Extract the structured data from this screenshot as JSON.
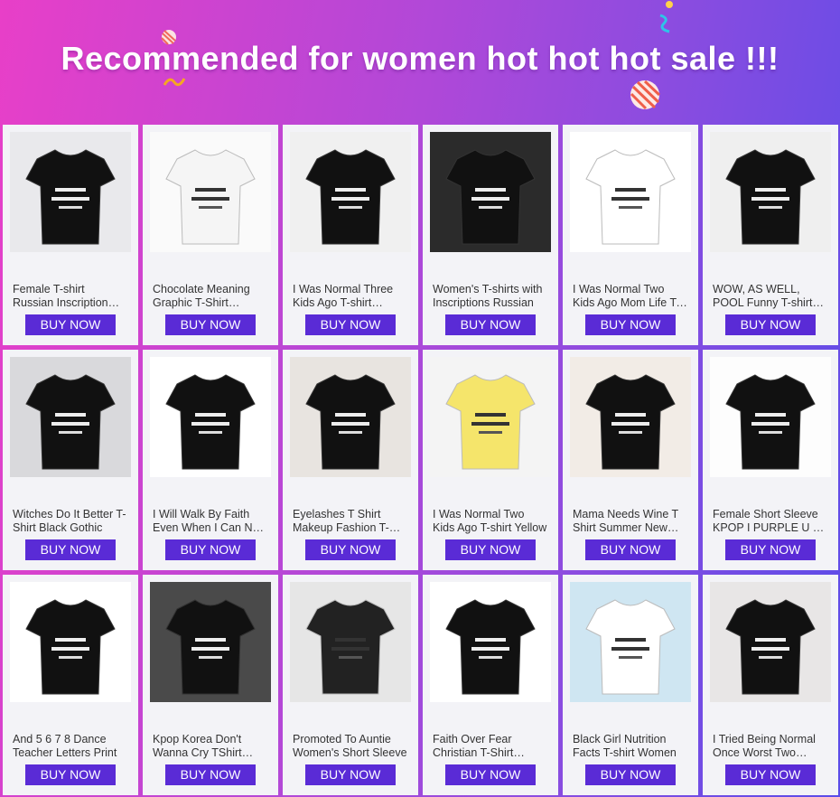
{
  "banner": {
    "title": "Recommended for women hot hot hot sale !!!"
  },
  "colors": {
    "button": "#5a2bd6",
    "card_bg": "#f3f3f7",
    "gradient_left": "#e83fc8",
    "gradient_right": "#5a4ce8"
  },
  "products": [
    {
      "title": "Female T-shirt Russian Inscription Print",
      "button": "BUY NOW",
      "image": "shirt-photo"
    },
    {
      "title": "Chocolate Meaning Graphic T-Shirt Women",
      "button": "BUY NOW",
      "image": "shirt-photo"
    },
    {
      "title": "I Was Normal Three Kids Ago T-shirt Casual",
      "button": "BUY NOW",
      "image": "shirt-photo"
    },
    {
      "title": "Women's T-shirts with Inscriptions Russian",
      "button": "BUY NOW",
      "image": "shirt-photo"
    },
    {
      "title": "I Was Normal Two Kids Ago Mom Life T-shirt",
      "button": "BUY NOW",
      "image": "shirt-photo"
    },
    {
      "title": "WOW, AS WELL, POOL Funny T-shirt Women",
      "button": "BUY NOW",
      "image": "shirt-photo"
    },
    {
      "title": "Witches Do It Better T-Shirt Black Gothic",
      "button": "BUY NOW",
      "image": "shirt-photo"
    },
    {
      "title": "I Will Walk By Faith Even When I Can Not See",
      "button": "BUY NOW",
      "image": "shirt-photo"
    },
    {
      "title": "Eyelashes T Shirt Makeup Fashion T-shirt",
      "button": "BUY NOW",
      "image": "shirt-photo"
    },
    {
      "title": "I Was Normal Two Kids Ago T-shirt Yellow",
      "button": "BUY NOW",
      "image": "shirt-photo"
    },
    {
      "title": "Mama Needs Wine T Shirt Summer New Tee",
      "button": "BUY NOW",
      "image": "shirt-photo"
    },
    {
      "title": "Female Short Sleeve KPOP I PURPLE U T-shirt",
      "button": "BUY NOW",
      "image": "shirt-photo"
    },
    {
      "title": "And 5 6 7 8 Dance Teacher Letters Print",
      "button": "BUY NOW",
      "image": "shirt-photo"
    },
    {
      "title": "Kpop Korea Don't Wanna Cry TShirt Women",
      "button": "BUY NOW",
      "image": "shirt-photo"
    },
    {
      "title": "Promoted To Auntie Women's Short Sleeve",
      "button": "BUY NOW",
      "image": "shirt-photo"
    },
    {
      "title": "Faith Over Fear Christian T-Shirt Women",
      "button": "BUY NOW",
      "image": "shirt-photo"
    },
    {
      "title": "Black Girl Nutrition Facts T-shirt Women",
      "button": "BUY NOW",
      "image": "shirt-photo"
    },
    {
      "title": "I Tried Being Normal Once Worst Two Minutes",
      "button": "BUY NOW",
      "image": "shirt-photo"
    }
  ]
}
